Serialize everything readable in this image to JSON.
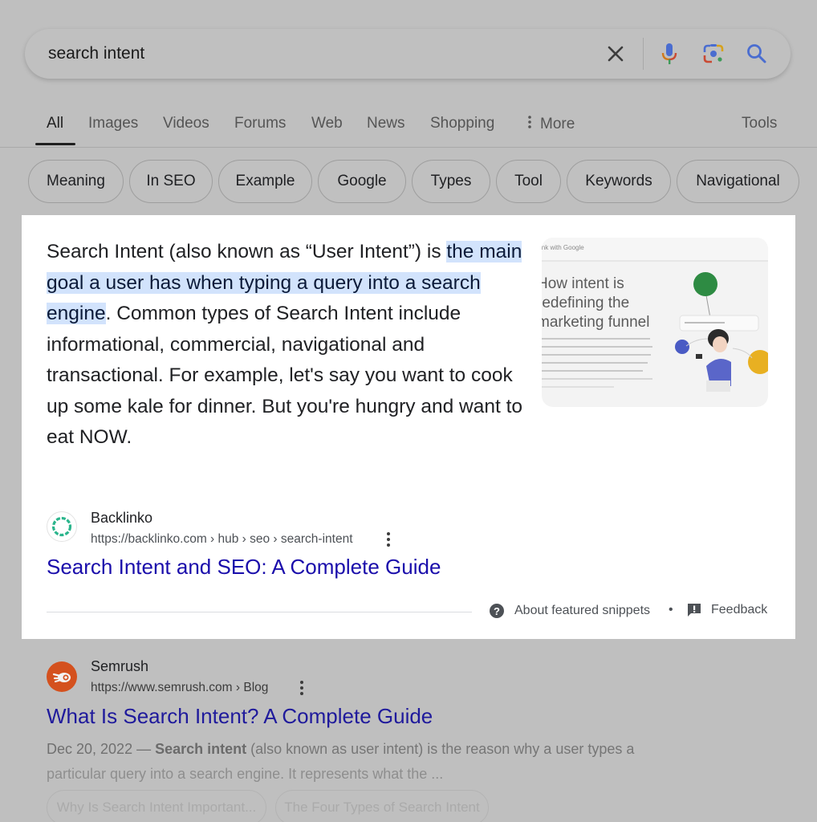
{
  "search": {
    "query": "search intent",
    "icons": [
      "clear-icon",
      "microphone-icon",
      "google-lens-icon",
      "search-icon"
    ]
  },
  "tabs": [
    {
      "label": "All",
      "active": true
    },
    {
      "label": "Images"
    },
    {
      "label": "Videos"
    },
    {
      "label": "Forums"
    },
    {
      "label": "Web"
    },
    {
      "label": "News"
    },
    {
      "label": "Shopping"
    },
    {
      "label": "More",
      "icon": "more-vert-icon"
    },
    {
      "label": "Tools"
    }
  ],
  "chips": [
    "Meaning",
    "In SEO",
    "Example",
    "Google",
    "Types",
    "Tool",
    "Keywords",
    "Navigational"
  ],
  "featured_snippet": {
    "text_before": "Search Intent (also known as “User Intent”) is ",
    "text_highlight": "the main goal a user has when typing a query into a search engine",
    "text_after": ". Common types of Search Intent include informational, commercial, navigational and transactional. For example, let's say you want to cook up some kale for dinner. But you're hungry and want to eat NOW.",
    "thumbnail": {
      "header": "ink with Google",
      "headline_lines": [
        "How intent is",
        "redefining the",
        "marketing funnel"
      ]
    },
    "source": {
      "name": "Backlinko",
      "url": "https://backlinko.com › hub › seo › search-intent",
      "title": "Search Intent and SEO: A Complete Guide"
    },
    "footer": {
      "about_label": "About featured snippets",
      "separator": "•",
      "feedback_label": "Feedback"
    },
    "colors": {
      "highlight": "#d2e3fc",
      "link": "#1a0dab",
      "favicon_ring": "#2bb58c"
    }
  },
  "result2": {
    "name": "Semrush",
    "url": "https://www.semrush.com › Blog",
    "title": "What Is Search Intent? A Complete Guide",
    "date": "Dec 20, 2022 — ",
    "desc_bold": "Search intent",
    "desc_line1_rest": " (also known as user intent) is the reason why a user types a",
    "desc_line2": "particular query into a search engine. It represents what the ...",
    "sitelinks": [
      "Why Is Search Intent Important...",
      "The Four Types of Search Intent"
    ],
    "favicon_color": "#d4511e"
  }
}
